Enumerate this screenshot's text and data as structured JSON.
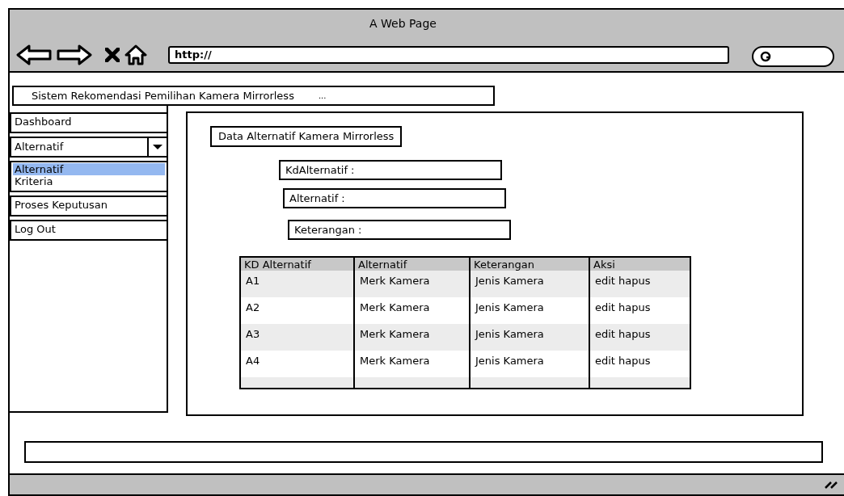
{
  "window": {
    "title": "A Web Page"
  },
  "address_bar": {
    "value": "http://"
  },
  "header": {
    "title": "Sistem Rekomendasi Pemilihan Kamera Mirrorless",
    "more": "..."
  },
  "sidebar": {
    "items": [
      {
        "kind": "button",
        "label": "Dashboard"
      },
      {
        "kind": "dropdown",
        "value": "Alternatif",
        "options": [
          {
            "label": "Alternatif",
            "selected": true
          },
          {
            "label": "Kriteria",
            "selected": false
          }
        ]
      },
      {
        "kind": "button",
        "label": "Proses Keputusan"
      },
      {
        "kind": "button",
        "label": "Log Out"
      }
    ]
  },
  "main": {
    "title": "Data Alternatif Kamera Mirrorless",
    "fields": [
      {
        "label": "KdAlternatif :"
      },
      {
        "label": "Alternatif :"
      },
      {
        "label": "Keterangan :"
      }
    ],
    "table": {
      "columns": [
        "KD Alternatif",
        "Alternatif",
        "Keterangan",
        "Aksi"
      ],
      "rows": [
        [
          "A1",
          "Merk Kamera",
          "Jenis Kamera",
          "edit hapus"
        ],
        [
          "A2",
          "Merk Kamera",
          "Jenis Kamera",
          "edit hapus"
        ],
        [
          "A3",
          "Merk Kamera",
          "Jenis Kamera",
          "edit hapus"
        ],
        [
          "A4",
          "Merk Kamera",
          "Jenis Kamera",
          "edit hapus"
        ]
      ]
    }
  }
}
